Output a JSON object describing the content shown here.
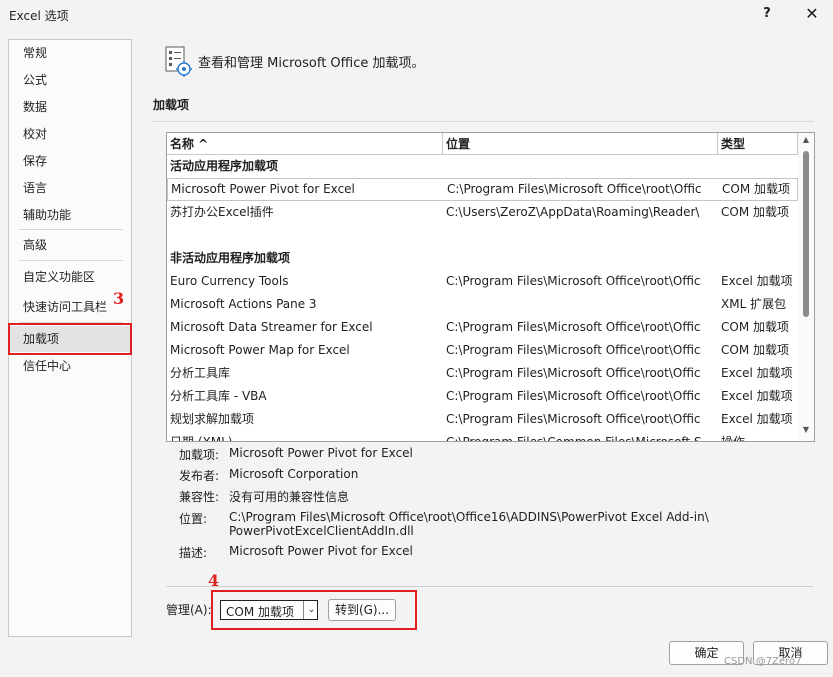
{
  "window": {
    "title": "Excel 选项",
    "help_label": "?",
    "close_label": "✕"
  },
  "sidebar": {
    "items": [
      {
        "label": "常规"
      },
      {
        "label": "公式"
      },
      {
        "label": "数据"
      },
      {
        "label": "校对"
      },
      {
        "label": "保存"
      },
      {
        "label": "语言"
      },
      {
        "label": "辅助功能"
      },
      {
        "label": "高级"
      },
      {
        "label": "自定义功能区"
      },
      {
        "label": "快速访问工具栏"
      },
      {
        "label": "加载项"
      },
      {
        "label": "信任中心"
      }
    ],
    "selected": "加载项"
  },
  "annotations": {
    "step3": "3",
    "step4": "4",
    "color": "#e02020"
  },
  "header": {
    "text": "查看和管理 Microsoft Office 加载项。",
    "icon": "addin-settings-icon"
  },
  "section": {
    "title": "加载项"
  },
  "table": {
    "columns": {
      "name": "名称 ^",
      "location": "位置",
      "type": "类型"
    },
    "groups": {
      "active": "活动应用程序加载项",
      "inactive": "非活动应用程序加载项"
    },
    "active_rows": [
      {
        "name": "Microsoft Power Pivot for Excel",
        "location": "C:\\Program Files\\Microsoft Office\\root\\Offic",
        "type": "COM 加载项"
      },
      {
        "name": "苏打办公Excel插件",
        "location": "C:\\Users\\ZeroZ\\AppData\\Roaming\\Reader\\",
        "type": "COM 加载项"
      }
    ],
    "inactive_rows": [
      {
        "name": "Euro Currency Tools",
        "location": "C:\\Program Files\\Microsoft Office\\root\\Offic",
        "type": "Excel 加载项"
      },
      {
        "name": "Microsoft Actions Pane 3",
        "location": "",
        "type": "XML 扩展包"
      },
      {
        "name": "Microsoft Data Streamer for Excel",
        "location": "C:\\Program Files\\Microsoft Office\\root\\Offic",
        "type": "COM 加载项"
      },
      {
        "name": "Microsoft Power Map for Excel",
        "location": "C:\\Program Files\\Microsoft Office\\root\\Offic",
        "type": "COM 加载项"
      },
      {
        "name": "分析工具库",
        "location": "C:\\Program Files\\Microsoft Office\\root\\Offic",
        "type": "Excel 加载项"
      },
      {
        "name": "分析工具库 - VBA",
        "location": "C:\\Program Files\\Microsoft Office\\root\\Offic",
        "type": "Excel 加载项"
      },
      {
        "name": "规划求解加载项",
        "location": "C:\\Program Files\\Microsoft Office\\root\\Offic",
        "type": "Excel 加载项"
      },
      {
        "name": "日期 (XML)",
        "location": "C:\\Program Files\\Common Files\\Microsoft S",
        "type": "操作"
      }
    ]
  },
  "details": {
    "addin_label": "加载项:",
    "addin_value": "Microsoft Power Pivot for Excel",
    "publisher_label": "发布者:",
    "publisher_value": "Microsoft Corporation",
    "compat_label": "兼容性:",
    "compat_value": "没有可用的兼容性信息",
    "location_label": "位置:",
    "location_value_line1": "C:\\Program Files\\Microsoft Office\\root\\Office16\\ADDINS\\PowerPivot Excel Add-in\\",
    "location_value_line2": "PowerPivotExcelClientAddIn.dll",
    "desc_label": "描述:",
    "desc_value": "Microsoft Power Pivot for Excel"
  },
  "manage": {
    "label": "管理(A):",
    "selected": "COM 加载项",
    "go_label": "转到(G)..."
  },
  "footer": {
    "ok_label": "确定",
    "cancel_label": "取消",
    "watermark": "CSDN @7Zero7"
  }
}
